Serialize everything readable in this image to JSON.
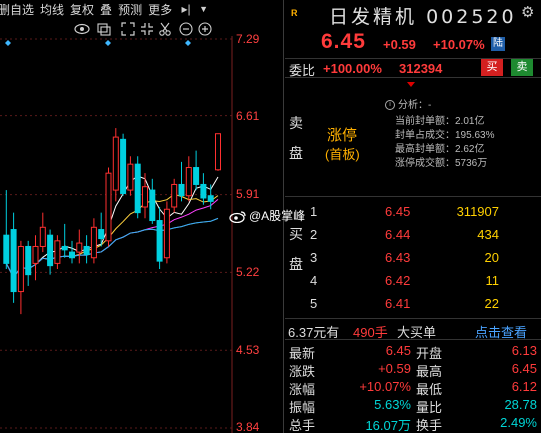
{
  "toolbar": {
    "items": [
      "删自选",
      "均线",
      "复权",
      "叠",
      "预测",
      "更多"
    ],
    "icons": [
      "eye-icon",
      "layers-icon",
      "expand-icon",
      "compress-icon",
      "scissors-icon",
      "minus-circle-icon",
      "plus-circle-icon",
      "arrow-right-bar-icon",
      "dropdown-icon"
    ]
  },
  "stock": {
    "name": "日发精机",
    "code": "002520",
    "price": "6.45",
    "change": "+0.59",
    "change_pct": "+10.07%",
    "tag": "陆",
    "badge": "R"
  },
  "weibi": {
    "label": "委比",
    "value": "+100.00%",
    "volume": "312394",
    "buy": "买",
    "sell": "卖"
  },
  "sell_side": {
    "label": "卖盘",
    "limit_label": "涨停",
    "limit_sub": "(首板)"
  },
  "analysis": {
    "title": "分析：-",
    "rows": [
      {
        "k": "当前封单额：",
        "v": "2.01亿"
      },
      {
        "k": "封单占成交：",
        "v": "195.63%"
      },
      {
        "k": "最高封单额：",
        "v": "2.62亿"
      },
      {
        "k": "涨停成交额：",
        "v": "5736万"
      }
    ]
  },
  "buy_side": {
    "label": "买盘",
    "rows": [
      {
        "level": "1",
        "price": "6.45",
        "volume": "311907"
      },
      {
        "level": "2",
        "price": "6.44",
        "volume": "434"
      },
      {
        "level": "3",
        "price": "6.43",
        "volume": "20"
      },
      {
        "level": "4",
        "price": "6.42",
        "volume": "11"
      },
      {
        "level": "5",
        "price": "6.41",
        "volume": "22"
      }
    ]
  },
  "big_order": {
    "price": "6.37元有",
    "hands": "490手",
    "label": "大买单",
    "link": "点击查看"
  },
  "stats": [
    {
      "k1": "最新",
      "v1": "6.45",
      "k2": "开盘",
      "v2": "6.13"
    },
    {
      "k1": "涨跌",
      "v1": "+0.59",
      "k2": "最高",
      "v2": "6.45"
    },
    {
      "k1": "涨幅",
      "v1": "+10.07%",
      "k2": "最低",
      "v2": "6.12"
    },
    {
      "k1": "振幅",
      "v1": "5.63%",
      "k2": "量比",
      "v2": "28.78"
    },
    {
      "k1": "总手",
      "v1": "16.07万",
      "k2": "换手",
      "v2": "2.49%"
    }
  ],
  "price_axis": [
    "7.29",
    "6.61",
    "5.91",
    "5.22",
    "4.53",
    "3.84"
  ],
  "watermark": "@A股掌峰",
  "colors": {
    "up": "#ff3b3b",
    "down": "#00d5d5",
    "accent": "#ffb000",
    "link": "#4aa3ff"
  },
  "chart_data": {
    "type": "candlestick",
    "ylim": [
      3.84,
      7.29
    ],
    "candles": [
      {
        "o": 5.55,
        "h": 5.95,
        "l": 5.25,
        "c": 5.3
      },
      {
        "o": 5.6,
        "h": 5.75,
        "l": 4.95,
        "c": 5.05
      },
      {
        "o": 5.05,
        "h": 5.5,
        "l": 4.85,
        "c": 5.45
      },
      {
        "o": 5.45,
        "h": 5.5,
        "l": 5.1,
        "c": 5.2
      },
      {
        "o": 5.3,
        "h": 5.55,
        "l": 5.15,
        "c": 5.45
      },
      {
        "o": 5.45,
        "h": 5.75,
        "l": 5.4,
        "c": 5.62
      },
      {
        "o": 5.55,
        "h": 5.6,
        "l": 5.2,
        "c": 5.28
      },
      {
        "o": 5.3,
        "h": 5.55,
        "l": 5.25,
        "c": 5.5
      },
      {
        "o": 5.45,
        "h": 5.65,
        "l": 5.35,
        "c": 5.42
      },
      {
        "o": 5.4,
        "h": 5.5,
        "l": 5.3,
        "c": 5.35
      },
      {
        "o": 5.4,
        "h": 5.6,
        "l": 5.3,
        "c": 5.48
      },
      {
        "o": 5.45,
        "h": 5.55,
        "l": 5.3,
        "c": 5.38
      },
      {
        "o": 5.35,
        "h": 5.7,
        "l": 5.3,
        "c": 5.62
      },
      {
        "o": 5.6,
        "h": 5.75,
        "l": 5.45,
        "c": 5.52
      },
      {
        "o": 5.5,
        "h": 6.15,
        "l": 5.45,
        "c": 6.1
      },
      {
        "o": 5.95,
        "h": 6.5,
        "l": 5.85,
        "c": 6.42
      },
      {
        "o": 6.4,
        "h": 6.45,
        "l": 5.9,
        "c": 5.92
      },
      {
        "o": 5.95,
        "h": 6.25,
        "l": 5.9,
        "c": 6.18
      },
      {
        "o": 6.18,
        "h": 6.25,
        "l": 5.7,
        "c": 5.75
      },
      {
        "o": 5.8,
        "h": 6.1,
        "l": 5.7,
        "c": 5.98
      },
      {
        "o": 5.95,
        "h": 6.05,
        "l": 5.65,
        "c": 5.68
      },
      {
        "o": 5.68,
        "h": 5.8,
        "l": 5.25,
        "c": 5.32
      },
      {
        "o": 5.35,
        "h": 5.85,
        "l": 5.3,
        "c": 5.78
      },
      {
        "o": 5.8,
        "h": 6.05,
        "l": 5.75,
        "c": 6.0
      },
      {
        "o": 6.0,
        "h": 6.2,
        "l": 5.85,
        "c": 5.9
      },
      {
        "o": 5.9,
        "h": 6.25,
        "l": 5.85,
        "c": 6.15
      },
      {
        "o": 6.15,
        "h": 6.3,
        "l": 5.95,
        "c": 6.0
      },
      {
        "o": 6.0,
        "h": 6.1,
        "l": 5.82,
        "c": 5.88
      },
      {
        "o": 5.9,
        "h": 6.0,
        "l": 5.78,
        "c": 5.85
      },
      {
        "o": 6.13,
        "h": 6.45,
        "l": 6.12,
        "c": 6.45
      }
    ]
  }
}
